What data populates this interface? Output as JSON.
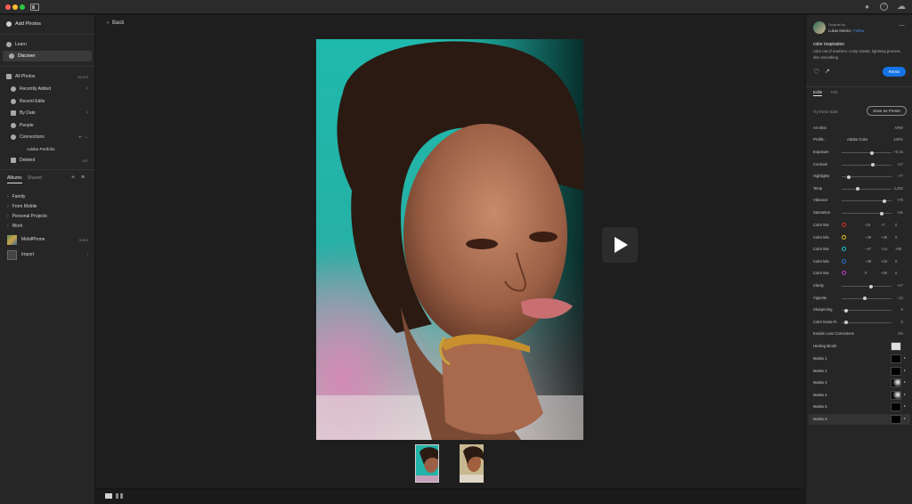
{
  "titlebar": {
    "icons": [
      "bell-icon",
      "help-icon",
      "cloud-icon"
    ]
  },
  "sidebar": {
    "add_photos": "Add Photos",
    "learn": "Learn",
    "discover": "Discover",
    "all_photos": "All Photos",
    "all_photos_count": "15,875",
    "recently_added": "Recently Added",
    "recent_edits": "Recent Edits",
    "by_date": "By Date",
    "people": "People",
    "connections": "Connections",
    "adobe_portfolio": "Adobe Portfolio",
    "deleted": "Deleted",
    "deleted_count": "237",
    "tab_albums": "Albums",
    "tab_shared": "Shared",
    "albums": [
      "Family",
      "From Mobile",
      "Personal Projects",
      "Work"
    ],
    "mobilephone": "MobilPhone",
    "mobilephone_count": "5,819",
    "import": "Import"
  },
  "main": {
    "back": "Back"
  },
  "panel": {
    "original_by": "Original by",
    "author": "Lukas Menke",
    "follow": "Follow",
    "title": "color inspiration",
    "description": "color out of nowhere; comp masks, lightning process, skin smoothing",
    "remix": "Remix",
    "tab_edits": "Edits",
    "tab_info": "Info",
    "try_edits": "Try these Edits",
    "save_preset": "Save as Preset",
    "as_shot": "As Shot",
    "as_shot_val": "ARW",
    "profile": "Profile :",
    "profile_val": "Adobe Color",
    "profile_amt": "100%",
    "sliders": [
      {
        "label": "Exposure",
        "value": "+0.15",
        "pos": 0.6
      },
      {
        "label": "Contrast",
        "value": "+17",
        "pos": 0.62
      },
      {
        "label": "Highlights",
        "value": "−77",
        "pos": 0.12
      },
      {
        "label": "Temp",
        "value": "4,252",
        "pos": 0.3
      },
      {
        "label": "Vibrance",
        "value": "+70",
        "pos": 0.85
      },
      {
        "label": "Saturation",
        "value": "+31",
        "pos": 0.8
      }
    ],
    "color_mix": [
      {
        "label": "Color Mix",
        "color": "#d93030",
        "v1": "-16",
        "v2": "+7",
        "v3": "0"
      },
      {
        "label": "Color Mix",
        "color": "#e6c319",
        "v1": "−29",
        "v2": "+46",
        "v3": "0"
      },
      {
        "label": "Color Mix",
        "color": "#1ec5c8",
        "v1": "−47",
        "v2": "+14",
        "v3": "+80"
      },
      {
        "label": "Color Mix",
        "color": "#2b6fd6",
        "v1": "−38",
        "v2": "+23",
        "v3": "0"
      },
      {
        "label": "Color Mix",
        "color": "#c43cc9",
        "v1": "0",
        "v2": "+30",
        "v3": "0"
      }
    ],
    "sliders2": [
      {
        "label": "Clarity",
        "value": "+17",
        "pos": 0.58
      },
      {
        "label": "Vignette",
        "value": "−12",
        "pos": 0.45
      },
      {
        "label": "Sharpening",
        "value": "0",
        "pos": 0.05
      },
      {
        "label": "Color Noise R.",
        "value": "0",
        "pos": 0.05
      }
    ],
    "lens": "Enable Lens Corrections",
    "lens_val": "On",
    "healing": "Healing Brush",
    "masks": [
      "Masks 1",
      "Masks 2",
      "Masks 3",
      "Masks 4",
      "Masks 5",
      "Masks 6"
    ]
  },
  "colors": {
    "accent": "#1473e6",
    "bg": "#1e1e1e",
    "panel": "#262626"
  }
}
